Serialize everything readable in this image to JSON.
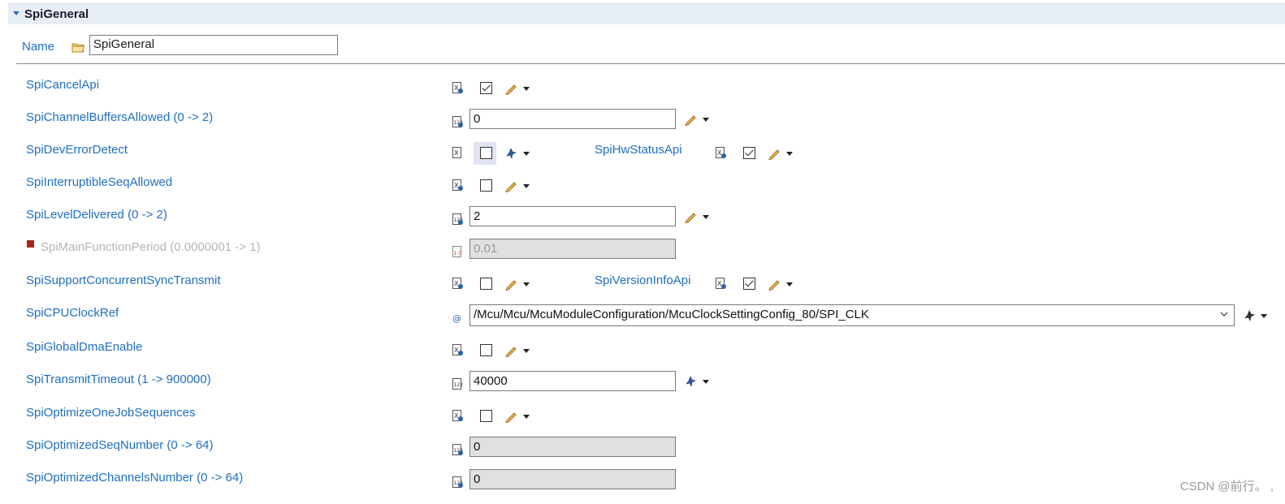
{
  "section": {
    "title": "SpiGeneral"
  },
  "name_row": {
    "label": "Name",
    "value": "SpiGeneral"
  },
  "rows": {
    "cancel_api": {
      "label": "SpiCancelApi",
      "checked": true
    },
    "channel_buffers": {
      "label": "SpiChannelBuffersAllowed (0 -> 2)",
      "value": "0"
    },
    "dev_error": {
      "label": "SpiDevErrorDetect",
      "checked": false
    },
    "hw_status": {
      "label": "SpiHwStatusApi",
      "checked": true
    },
    "interruptible": {
      "label": "SpiInterruptibleSeqAllowed",
      "checked": false
    },
    "level_delivered": {
      "label": "SpiLevelDelivered (0 -> 2)",
      "value": "2"
    },
    "main_function": {
      "label": "SpiMainFunctionPeriod (0.0000001 -> 1)",
      "value": "0.01"
    },
    "concurrent": {
      "label": "SpiSupportConcurrentSyncTransmit",
      "checked": false
    },
    "version_info": {
      "label": "SpiVersionInfoApi",
      "checked": true
    },
    "cpu_clock": {
      "label": "SpiCPUClockRef",
      "value": "/Mcu/Mcu/McuModuleConfiguration/McuClockSettingConfig_80/SPI_CLK"
    },
    "global_dma": {
      "label": "SpiGlobalDmaEnable",
      "checked": false
    },
    "transmit_timeout": {
      "label": "SpiTransmitTimeout (1 -> 900000)",
      "value": "40000"
    },
    "optimize_one_job": {
      "label": "SpiOptimizeOneJobSequences",
      "checked": false
    },
    "optimized_seq": {
      "label": "SpiOptimizedSeqNumber (0 -> 64)",
      "value": "0"
    },
    "optimized_channels": {
      "label": "SpiOptimizedChannelsNumber (0 -> 64)",
      "value": "0"
    }
  },
  "icons": {
    "boolean_type": "boolean-type-icon",
    "integer_type": "integer-type-icon",
    "float_type": "float-type-icon",
    "reference_type": "reference-type-icon",
    "edit": "pencil-icon",
    "calculated": "calculated-gear-icon",
    "folder": "folder-icon"
  },
  "colors": {
    "label": "#1e6fc2",
    "header_bg": "#e8eef6",
    "error_marker": "#a8251c"
  },
  "watermark": "CSDN @前行。 ,"
}
